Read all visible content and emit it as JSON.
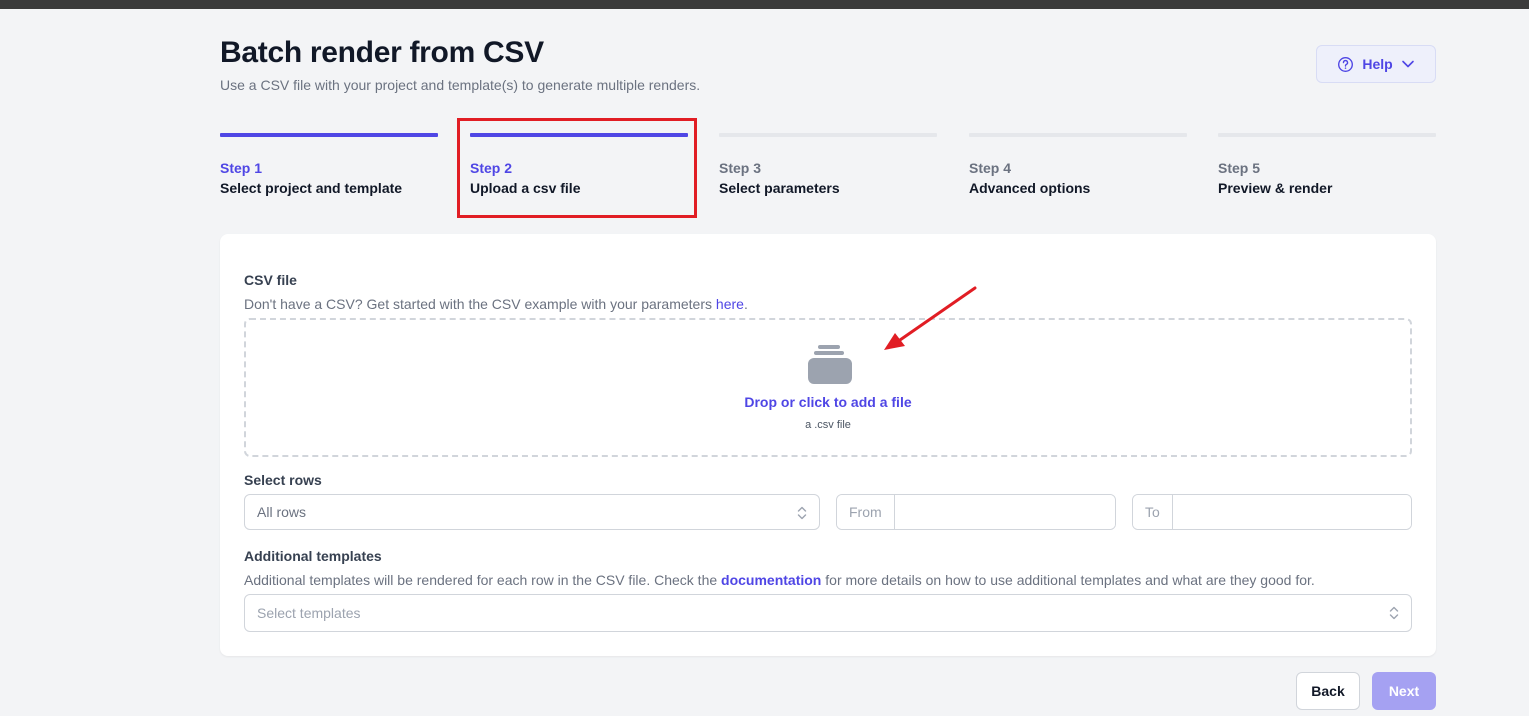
{
  "page": {
    "title": "Batch render from CSV",
    "subtitle": "Use a CSV file with your project and template(s) to generate multiple renders."
  },
  "help": {
    "label": "Help",
    "icon": "question-circle-icon",
    "chevron": "chevron-down-icon"
  },
  "steps": [
    {
      "num": "Step 1",
      "name": "Select project and template",
      "state": "complete"
    },
    {
      "num": "Step 2",
      "name": "Upload a csv file",
      "state": "current"
    },
    {
      "num": "Step 3",
      "name": "Select parameters",
      "state": "upcoming"
    },
    {
      "num": "Step 4",
      "name": "Advanced options",
      "state": "upcoming"
    },
    {
      "num": "Step 5",
      "name": "Preview & render",
      "state": "upcoming"
    }
  ],
  "csv": {
    "label": "CSV file",
    "hint_prefix": "Don't have a CSV? Get started with the CSV example with your parameters ",
    "hint_link": "here",
    "hint_suffix": ".",
    "dropzone_main": "Drop or click to add a file",
    "dropzone_sub": "a .csv file",
    "dropzone_icon": "file-stack-icon"
  },
  "rows": {
    "label": "Select rows",
    "select_value": "All rows",
    "from_label": "From",
    "to_label": "To",
    "from_value": "",
    "to_value": ""
  },
  "templates": {
    "label": "Additional templates",
    "hint_prefix": "Additional templates will be rendered for each row in the CSV file. Check the ",
    "hint_link": "documentation",
    "hint_suffix": " for more details on how to use additional templates and what are they good for.",
    "placeholder": "Select templates"
  },
  "footer": {
    "back": "Back",
    "next": "Next"
  },
  "colors": {
    "accent": "#4f46e5",
    "accent_disabled": "#a5a1f2",
    "highlight": "#e11d24",
    "annotation_arrow": "#e11d24"
  }
}
